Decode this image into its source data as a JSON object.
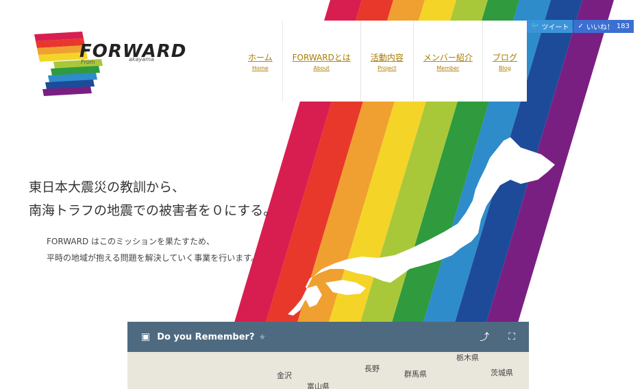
{
  "logo": {
    "name": "FORWARD",
    "from": "From",
    "place": "akayama"
  },
  "nav": [
    {
      "jp": "ホーム",
      "en": "Home"
    },
    {
      "jp": "FORWARDとは",
      "en": "About"
    },
    {
      "jp": "活動内容",
      "en": "Project"
    },
    {
      "jp": "メンバー紹介",
      "en": "Member"
    },
    {
      "jp": "ブログ",
      "en": "Blog"
    }
  ],
  "social": {
    "tweet": "ツイート",
    "like": "いいね！",
    "like_count": "183"
  },
  "hero": {
    "line1": "東日本大震災の教訓から、",
    "line2": "南海トラフの地震での被害者を０にする。",
    "sub1": "FORWARD はこのミッションを果たすため、",
    "sub2": "平時の地域が抱える問題を解決していく事業を行います。"
  },
  "map": {
    "title": "Do you Remember?",
    "labels": {
      "kanazawa": "金沢",
      "nagano": "長野",
      "gunma": "群馬県",
      "tochigi": "栃木県",
      "ibaraki": "茨城県",
      "toyama": "富山県"
    }
  },
  "colors": {
    "rainbow": [
      "#d81e50",
      "#e8382b",
      "#f0a030",
      "#f5d428",
      "#a8c83a",
      "#2f9a3e",
      "#2e8ccb",
      "#1d4b9a",
      "#7a1f82"
    ]
  }
}
